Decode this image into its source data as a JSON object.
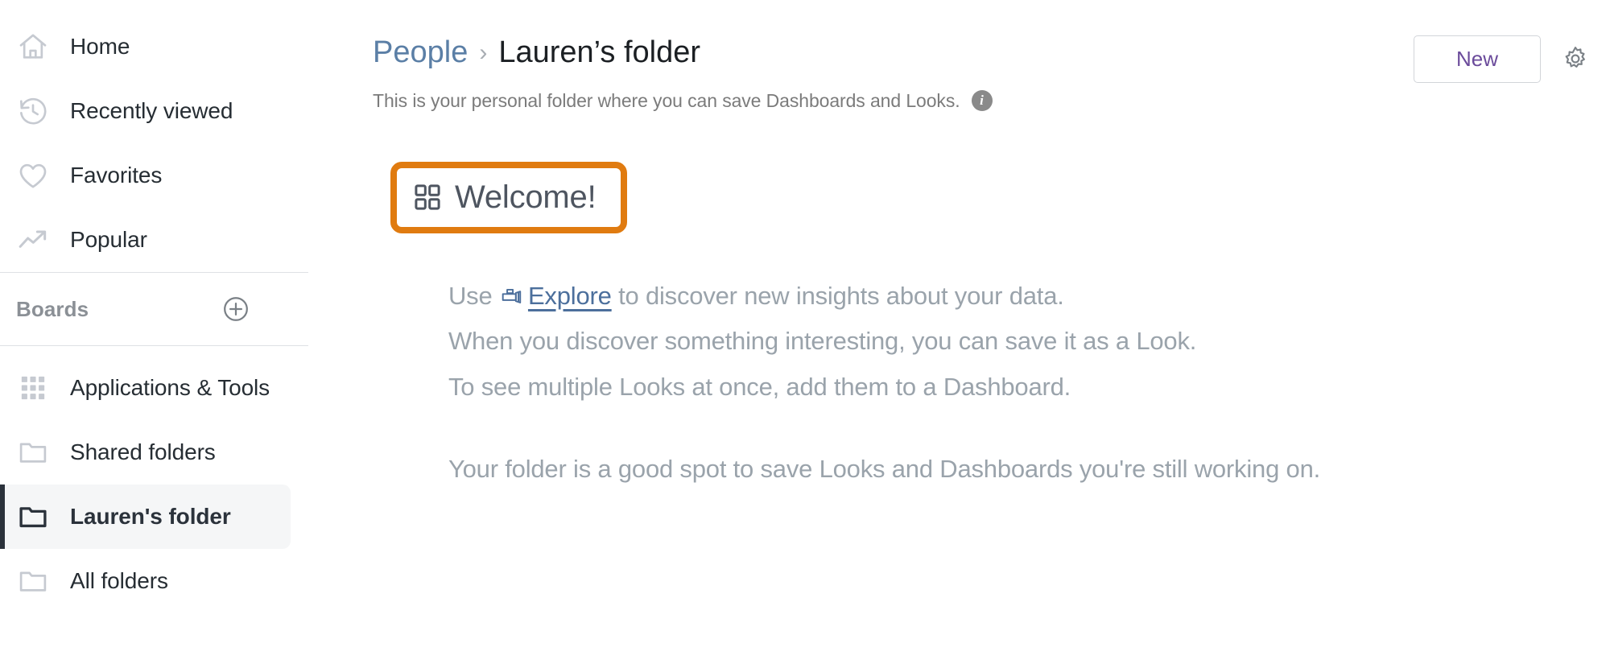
{
  "sidebar": {
    "primary_items": [
      {
        "label": "Home",
        "icon": "home-icon",
        "selected": false
      },
      {
        "label": "Recently viewed",
        "icon": "history-clock-icon",
        "selected": false
      },
      {
        "label": "Favorites",
        "icon": "heart-icon",
        "selected": false
      },
      {
        "label": "Popular",
        "icon": "trending-up-icon",
        "selected": false
      }
    ],
    "boards_section": {
      "title": "Boards",
      "add_icon": "plus-circle-icon"
    },
    "folder_items": [
      {
        "label": "Applications & Tools",
        "icon": "grid-dots-icon",
        "selected": false
      },
      {
        "label": "Shared folders",
        "icon": "folder-icon",
        "selected": false
      },
      {
        "label": "Lauren's folder",
        "icon": "folder-icon",
        "selected": true
      },
      {
        "label": "All folders",
        "icon": "folder-icon",
        "selected": false
      }
    ]
  },
  "header": {
    "breadcrumb": {
      "parent": "People",
      "separator": "›",
      "current": "Lauren’s folder"
    },
    "subtitle": "This is your personal folder where you can save Dashboards and Looks.",
    "info_icon_glyph": "i",
    "new_button_label": "New",
    "gear_icon": "gear-icon"
  },
  "content": {
    "welcome": {
      "title": "Welcome!",
      "icon": "dashboard-grid-icon",
      "highlight_color": "#e07b10"
    },
    "lines": [
      {
        "prefix": "Use ",
        "link": "Explore",
        "link_icon": "explore-telescope-icon",
        "suffix": " to discover new insights about your data."
      },
      {
        "text": "When you discover something interesting, you can save it as a Look."
      },
      {
        "text": "To see multiple Looks at once, add them to a Dashboard."
      },
      {
        "text": "Your folder is a good spot to save Looks and Dashboards you're still working on."
      }
    ]
  },
  "colors": {
    "accent_purple": "#6b4b9b",
    "link_blue": "#5b7fa6",
    "highlight_orange": "#e07b10",
    "body_gray": "#9aa3ab",
    "selected_bg": "#f5f6f7"
  }
}
